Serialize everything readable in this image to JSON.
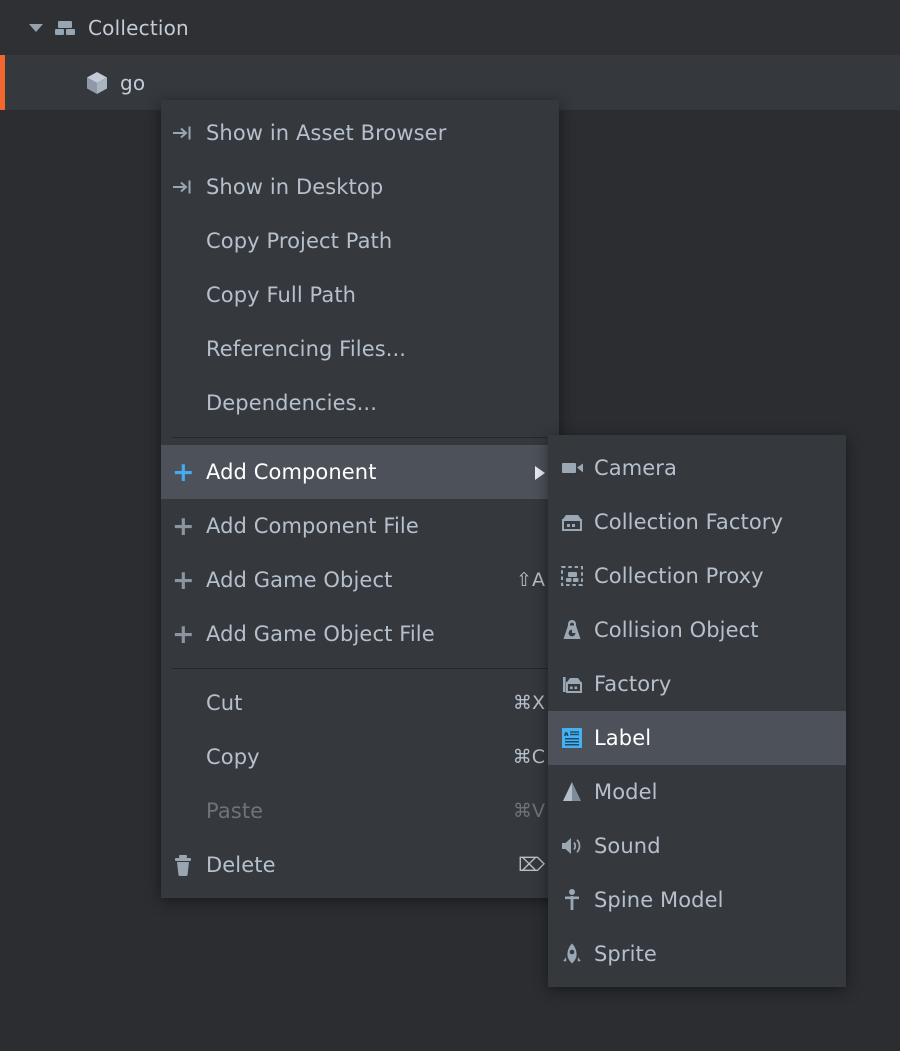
{
  "outliner": {
    "rows": [
      {
        "label": "Collection",
        "icon": "collection-icon",
        "expanded": true,
        "selected": false
      },
      {
        "label": "go",
        "icon": "game-object-icon",
        "expanded": false,
        "selected": true
      }
    ]
  },
  "context_menu": {
    "groups": [
      {
        "items": [
          {
            "label": "Show in Asset Browser",
            "icon": "show-in-target-icon",
            "accel": "",
            "state": "normal"
          },
          {
            "label": "Show in Desktop",
            "icon": "show-in-target-icon",
            "accel": "",
            "state": "normal"
          },
          {
            "label": "Copy Project Path",
            "icon": "",
            "accel": "",
            "state": "normal"
          },
          {
            "label": "Copy Full Path",
            "icon": "",
            "accel": "",
            "state": "normal"
          },
          {
            "label": "Referencing Files...",
            "icon": "",
            "accel": "",
            "state": "normal"
          },
          {
            "label": "Dependencies...",
            "icon": "",
            "accel": "",
            "state": "normal"
          }
        ]
      },
      {
        "items": [
          {
            "label": "Add Component",
            "icon": "plus-icon",
            "accel": "",
            "state": "selected",
            "submenu": true
          },
          {
            "label": "Add Component File",
            "icon": "plus-icon",
            "accel": "",
            "state": "normal"
          },
          {
            "label": "Add Game Object",
            "icon": "plus-icon",
            "accel": "⇧A",
            "state": "normal"
          },
          {
            "label": "Add Game Object File",
            "icon": "plus-icon",
            "accel": "",
            "state": "normal"
          }
        ]
      },
      {
        "items": [
          {
            "label": "Cut",
            "icon": "",
            "accel": "⌘X",
            "state": "normal"
          },
          {
            "label": "Copy",
            "icon": "",
            "accel": "⌘C",
            "state": "normal"
          },
          {
            "label": "Paste",
            "icon": "",
            "accel": "⌘V",
            "state": "disabled"
          },
          {
            "label": "Delete",
            "icon": "trash-icon",
            "accel": "⌦",
            "state": "normal"
          }
        ]
      }
    ]
  },
  "submenu": {
    "items": [
      {
        "label": "Camera",
        "icon": "camera-icon",
        "state": "normal"
      },
      {
        "label": "Collection Factory",
        "icon": "collection-factory-icon",
        "state": "normal"
      },
      {
        "label": "Collection Proxy",
        "icon": "collection-proxy-icon",
        "state": "normal"
      },
      {
        "label": "Collision Object",
        "icon": "collision-object-icon",
        "state": "normal"
      },
      {
        "label": "Factory",
        "icon": "factory-icon",
        "state": "normal"
      },
      {
        "label": "Label",
        "icon": "label-icon",
        "state": "selected"
      },
      {
        "label": "Model",
        "icon": "model-icon",
        "state": "normal"
      },
      {
        "label": "Sound",
        "icon": "sound-icon",
        "state": "normal"
      },
      {
        "label": "Spine Model",
        "icon": "spine-model-icon",
        "state": "normal"
      },
      {
        "label": "Sprite",
        "icon": "sprite-icon",
        "state": "normal"
      }
    ]
  },
  "colors": {
    "background": "#2b2d31",
    "menu_background": "#35383d",
    "highlight": "#4d525a",
    "text": "#b6c0cc",
    "text_disabled": "#6d737c",
    "accent_blue": "#47a9f0",
    "selection_marker_orange": "#f0682e",
    "icon_gray": "#97a4b2"
  }
}
